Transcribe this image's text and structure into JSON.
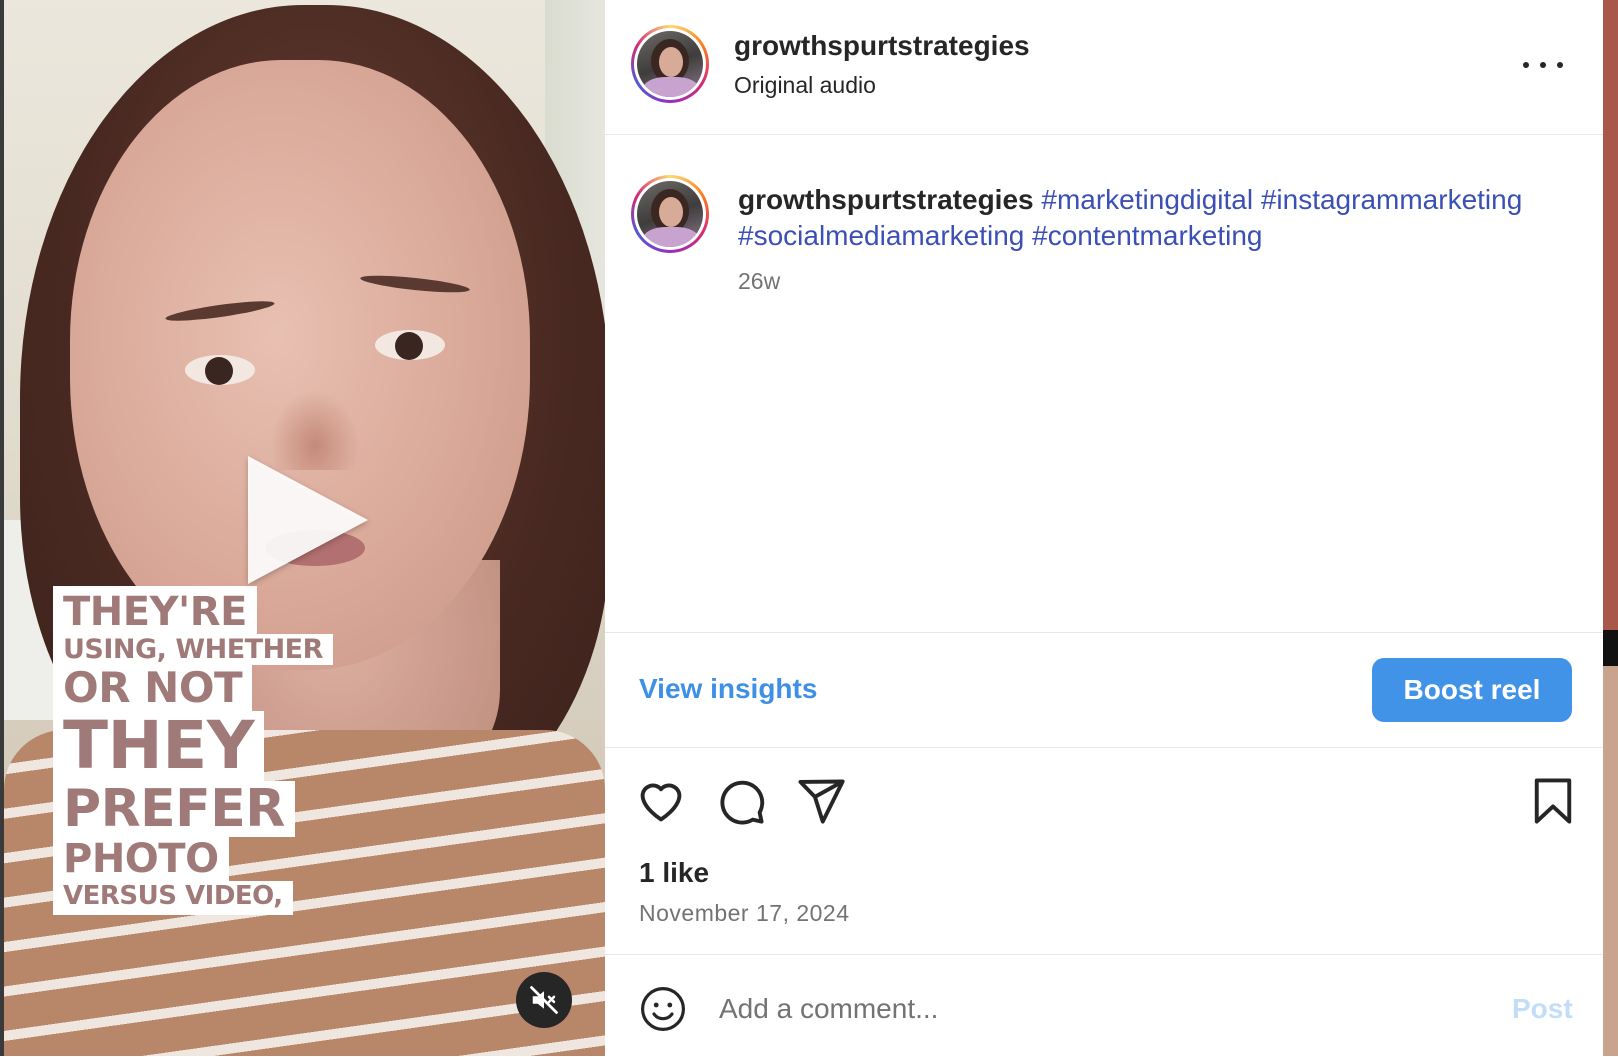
{
  "video": {
    "caption_lines": [
      "THEY'RE",
      "USING, WHETHER",
      "OR NOT",
      "THEY",
      "PREFER",
      "PHOTO",
      "VERSUS VIDEO,"
    ]
  },
  "header": {
    "username": "growthspurtstrategies",
    "audio": "Original audio"
  },
  "caption": {
    "username": "growthspurtstrategies",
    "hashtags": [
      "#marketingdigital",
      "#instagrammarketing",
      "#socialmediamarketing",
      "#contentmarketing"
    ],
    "time": "26w"
  },
  "insights": {
    "view_label": "View insights",
    "boost_label": "Boost reel"
  },
  "actions": {
    "icons": [
      "heart-icon",
      "comment-icon",
      "share-icon",
      "bookmark-icon"
    ],
    "likes": "1 like",
    "date": "November 17, 2024"
  },
  "comment": {
    "placeholder": "Add a comment...",
    "post_label": "Post"
  },
  "colors": {
    "link_blue": "#3e8fe6",
    "button_blue": "#4193e8",
    "hashtag": "#3b4fb5",
    "caption_text": "#a07a78"
  }
}
